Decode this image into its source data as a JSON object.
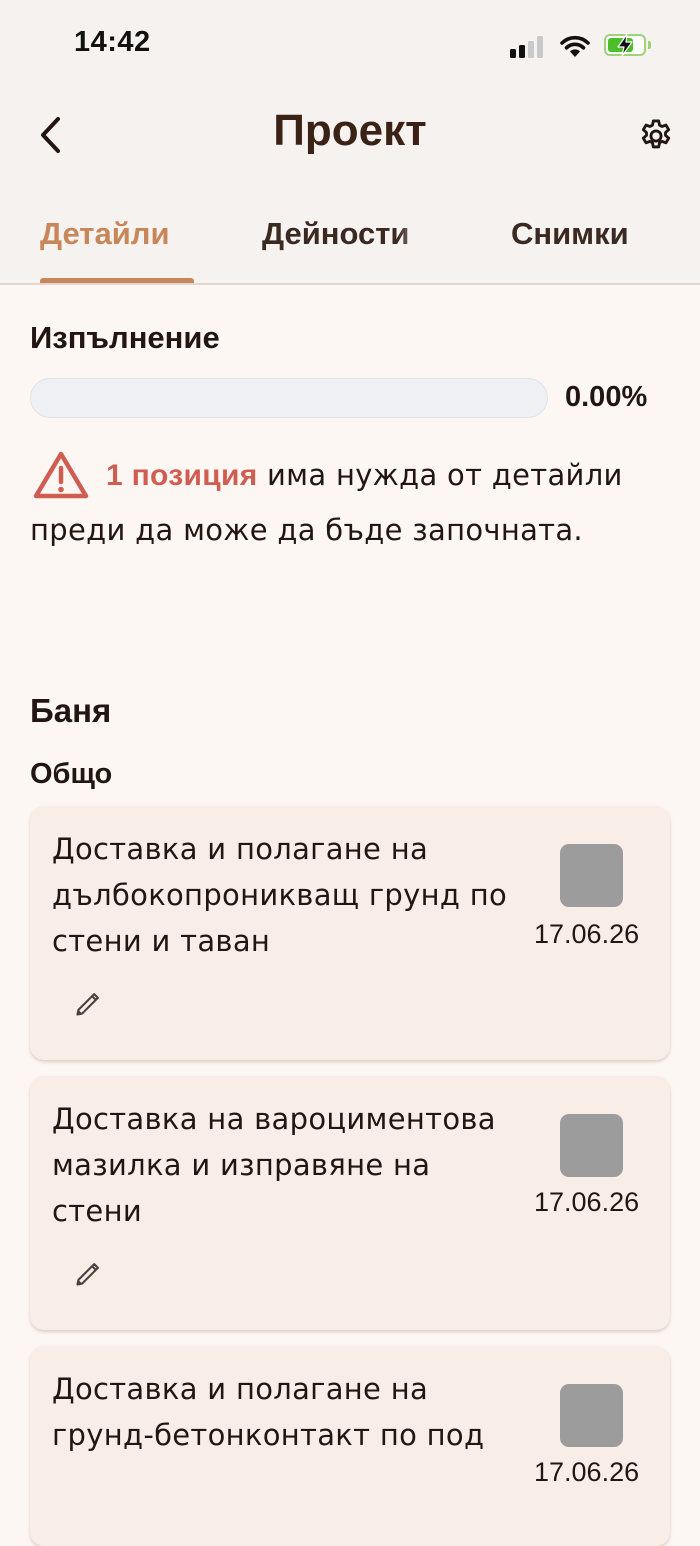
{
  "status_bar": {
    "time": "14:42",
    "icons": [
      "signal-icon",
      "wifi-icon",
      "battery-charging-icon"
    ]
  },
  "header": {
    "title": "Проект",
    "back_icon": "chevron-left-icon",
    "settings_icon": "gear-icon"
  },
  "tabs": [
    {
      "label": "Детайли",
      "active": true
    },
    {
      "label": "Дейности",
      "active": false
    },
    {
      "label": "Снимки",
      "active": false
    }
  ],
  "progress": {
    "label": "Изпълнение",
    "value_text": "0.00%",
    "fraction": 0.0
  },
  "warning": {
    "icon": "warning-triangle-icon",
    "highlight": "1 позиция",
    "text": " има нужда от детайли преди да може да бъде започната."
  },
  "section": {
    "room": "Баня",
    "group": "Общо"
  },
  "items": [
    {
      "title": "Доставка и полагане на дълбокопроникващ грунд по стени и таван",
      "date": "17.06.26",
      "edit_icon": "pencil-icon"
    },
    {
      "title": "Доставка на вароциментова мазилка и изправяне на стени",
      "date": "17.06.26",
      "edit_icon": "pencil-icon"
    },
    {
      "title": "Доставка и полагане на грунд-бетонконтакт по под",
      "date": "17.06.26"
    }
  ],
  "colors": {
    "accent": "#c8875a",
    "warning": "#d05d52",
    "card_bg": "#f8ede7",
    "page_bg": "#fdf7f3",
    "checkbox": "#9c9c9c"
  }
}
